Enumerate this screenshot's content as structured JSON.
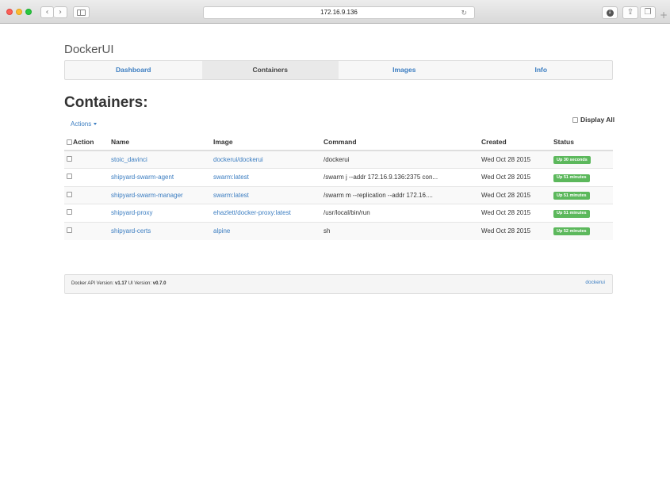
{
  "browser": {
    "url": "172.16.9.136"
  },
  "brand": "DockerUI",
  "nav": {
    "tabs": [
      {
        "label": "Dashboard"
      },
      {
        "label": "Containers"
      },
      {
        "label": "Images"
      },
      {
        "label": "Info"
      }
    ],
    "active": "Containers"
  },
  "page": {
    "title": "Containers:",
    "actions_label": "Actions",
    "display_all_label": "Display All"
  },
  "table": {
    "headers": {
      "action": "Action",
      "name": "Name",
      "image": "Image",
      "command": "Command",
      "created": "Created",
      "status": "Status"
    },
    "rows": [
      {
        "name": "stoic_davinci",
        "image": "dockerui/dockerui",
        "command": "/dockerui",
        "created": "Wed Oct 28 2015",
        "status": "Up 30 seconds"
      },
      {
        "name": "shipyard-swarm-agent",
        "image": "swarm:latest",
        "command": "/swarm j --addr 172.16.9.136:2375 con...",
        "created": "Wed Oct 28 2015",
        "status": "Up 51 minutes"
      },
      {
        "name": "shipyard-swarm-manager",
        "image": "swarm:latest",
        "command": "/swarm m --replication --addr 172.16....",
        "created": "Wed Oct 28 2015",
        "status": "Up 51 minutes"
      },
      {
        "name": "shipyard-proxy",
        "image": "ehazlett/docker-proxy:latest",
        "command": "/usr/local/bin/run",
        "created": "Wed Oct 28 2015",
        "status": "Up 51 minutes"
      },
      {
        "name": "shipyard-certs",
        "image": "alpine",
        "command": "sh",
        "created": "Wed Oct 28 2015",
        "status": "Up 52 minutes"
      }
    ]
  },
  "footer": {
    "api_label": "Docker API Version:",
    "api_version": "v1.17",
    "ui_label": "UI Version:",
    "ui_version": "v0.7.0",
    "link": "dockerui"
  },
  "colors": {
    "link": "#3b7dc1",
    "status_badge": "#5cb85c"
  }
}
